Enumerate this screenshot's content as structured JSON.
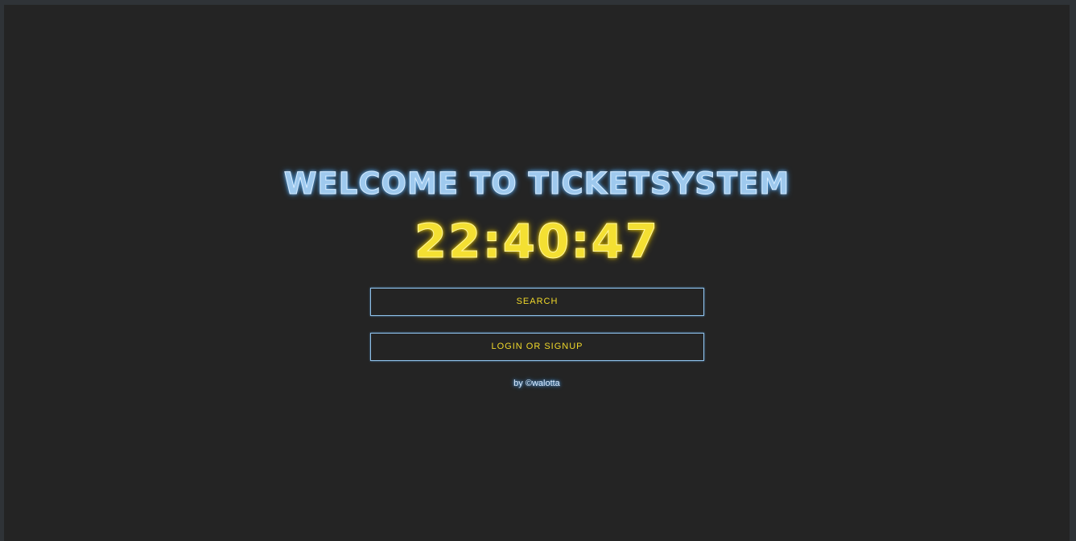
{
  "page": {
    "title": "WELCOME TO TICKETSYSTEM",
    "clock": "22:40:47",
    "buttons": {
      "search": "SEARCH",
      "login": "LOGIN OR SIGNUP"
    },
    "credit": "by ©walotta"
  },
  "colors": {
    "background": "#242424",
    "title_glow": "#9ec9ee",
    "clock_glow": "#f4e032",
    "button_border": "#8fc0e8",
    "button_text": "#f1d92a"
  }
}
